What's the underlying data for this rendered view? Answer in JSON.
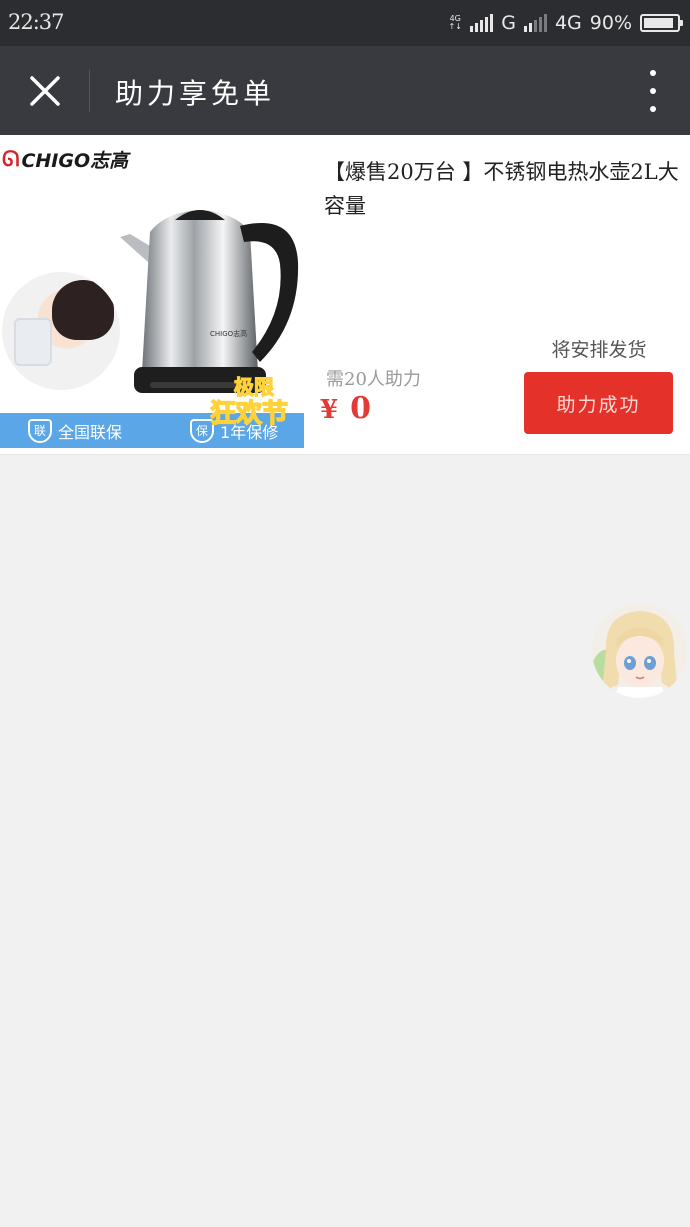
{
  "status_bar": {
    "time": "22:37",
    "net_small_top": "4G",
    "net_small_bottom": "↑↓",
    "net_g": "G",
    "net_4g": "4G",
    "battery_text": "90%",
    "battery_level": 0.9
  },
  "titlebar": {
    "title": "助力享免单"
  },
  "product": {
    "brand": "CHIGO志高",
    "name": "【爆售20万台 】不锈钢电热水壶2L大容量",
    "strip_left": "全国联保",
    "strip_left_badge": "联",
    "strip_right": "1年保修",
    "strip_right_badge": "保",
    "promo_line1": "极限",
    "promo_line2": "狂欢节",
    "ship_note": "将安排发货",
    "required_label": "需20人助力",
    "price_symbol": "¥",
    "price_value": "0",
    "action_label": "助力成功"
  },
  "colors": {
    "status_bar": "#2c2d31",
    "title_bar": "#393a3f",
    "accent_red": "#e4322a",
    "background": "#f1f1f1"
  }
}
